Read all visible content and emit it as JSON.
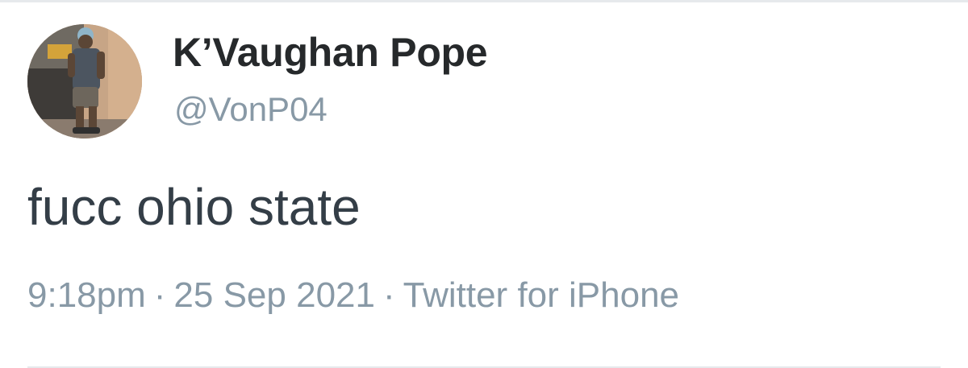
{
  "user": {
    "display_name": "K’Vaughan Pope",
    "handle": "@VonP04",
    "avatar_icon": "profile-photo"
  },
  "tweet": {
    "text": "fucc ohio state",
    "time": "9:18pm",
    "date": "25 Sep 2021",
    "source": "Twitter for iPhone",
    "separator": "·"
  },
  "colors": {
    "name": "#14171a",
    "secondary": "#8899a6",
    "body_text": "#343e47",
    "divider": "#e6e9ec"
  }
}
